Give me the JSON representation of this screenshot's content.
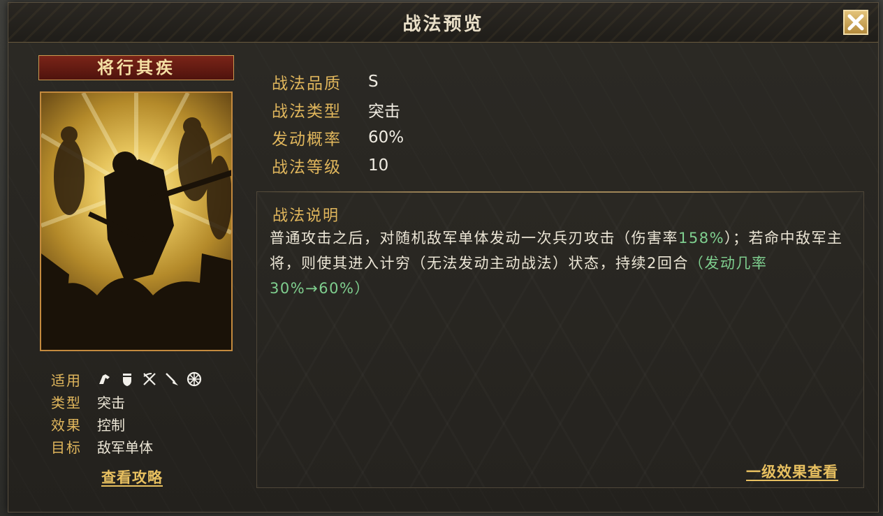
{
  "dialog": {
    "title": "战法预览",
    "close_icon": "close-x-icon"
  },
  "skill": {
    "name": "将行其疾",
    "applicable_label": "适用",
    "applicable_units": [
      "cavalry-icon",
      "shield-icon",
      "archer-icon",
      "spear-icon",
      "siege-wheel-icon"
    ],
    "type_label": "类型",
    "type_value": "突击",
    "effect_label": "效果",
    "effect_value": "控制",
    "target_label": "目标",
    "target_value": "敌军单体",
    "guide_link": "查看攻略"
  },
  "stats": [
    {
      "label": "战法品质",
      "value": "S"
    },
    {
      "label": "战法类型",
      "value": "突击"
    },
    {
      "label": "发动概率",
      "value": "60%"
    },
    {
      "label": "战法等级",
      "value": "10"
    }
  ],
  "description": {
    "title": "战法说明",
    "text_1": "普通攻击之后，对随机敌军单体发动一次兵刃攻击（伤害率",
    "text_2": "158%",
    "text_3": "）；若命中敌军主将，则使其进入计穷（无法发动主动战法）状态，持续2回合",
    "text_4": "（发动几率30%→60%）",
    "level_link": "一级效果查看"
  },
  "colors": {
    "accent_gold": "#e0b65c",
    "highlight_green": "#7fcf8f",
    "banner_red": "#7a2418"
  }
}
